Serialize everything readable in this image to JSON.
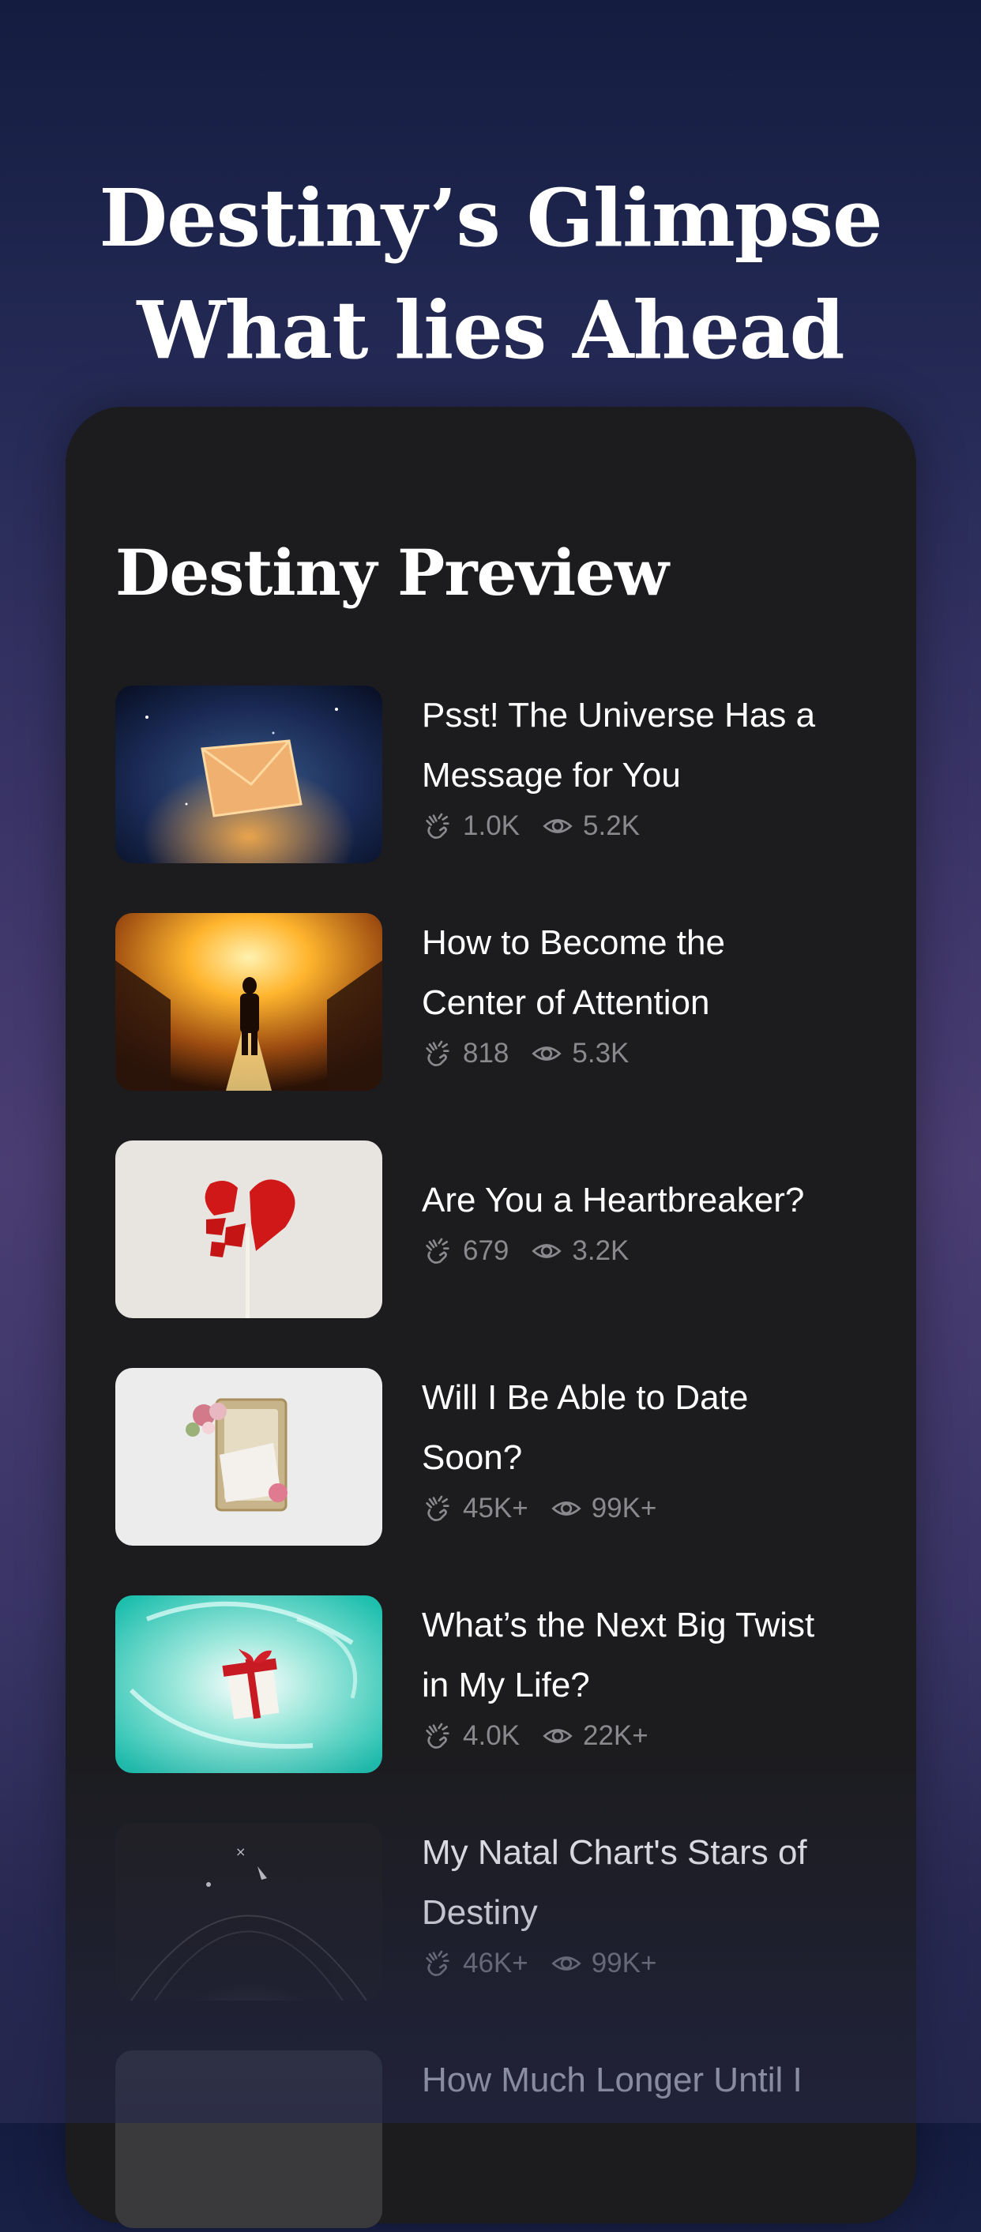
{
  "hero": {
    "line1": "Destiny’s Glimpse",
    "line2": "What lies Ahead"
  },
  "card": {
    "title": "Destiny Preview",
    "items": [
      {
        "title_line1": "Psst! The Universe Has a",
        "title_line2": "Message for You",
        "claps": "1.0K",
        "views": "5.2K",
        "image": "glowing-envelope-galaxy"
      },
      {
        "title_line1": "How to Become the",
        "title_line2": "Center of Attention",
        "claps": "818",
        "views": "5.3K",
        "image": "man-walking-golden-light"
      },
      {
        "title_line1": "Are You a Heartbreaker?",
        "title_line2": "",
        "claps": "679",
        "views": "3.2K",
        "image": "broken-heart-lollipop"
      },
      {
        "title_line1": "Will I Be Able to Date",
        "title_line2": "Soon?",
        "claps": "45K+",
        "views": "99K+",
        "image": "floral-card"
      },
      {
        "title_line1": "What’s the Next Big Twist",
        "title_line2": "in My Life?",
        "claps": "4.0K",
        "views": "22K+",
        "image": "gift-box-swirl"
      },
      {
        "title_line1": "My Natal Chart's Stars of",
        "title_line2": "Destiny",
        "claps": "46K+",
        "views": "99K+",
        "image": "planet-orbit"
      },
      {
        "title_line1": "How Much Longer Until I",
        "title_line2": "",
        "claps": "",
        "views": "",
        "image": "dark-thumbnail"
      }
    ]
  },
  "icons": {
    "claps": "clapping-hands-icon",
    "views": "eye-icon"
  },
  "colors": {
    "card_bg": "#1c1c1e",
    "stat_text": "#8a8a8e"
  }
}
